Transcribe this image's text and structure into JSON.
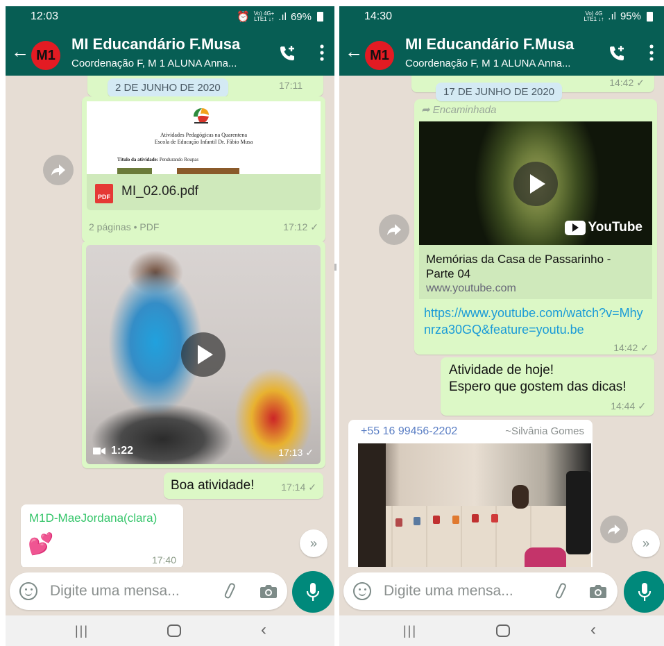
{
  "left": {
    "status": {
      "time": "12:03",
      "net_top": "Vo) 4G+",
      "net_bottom": "LTE1 ↓↑",
      "battery": "69%"
    },
    "header": {
      "avatar": "M1",
      "title": "MI Educandário F.Musa",
      "subtitle": "Coordenação F, M 1 ALUNA Anna..."
    },
    "messages": {
      "date_chip": "2 DE JUNHO DE 2020",
      "prev_time": "17:11",
      "pdf": {
        "doc_line1": "Atividades Pedagógicas na Quarentena",
        "doc_line2": "Escola de Educação Infantil Dr. Fábio Musa",
        "doc_label": "Título da atividade:",
        "doc_value": "Pendurando Roupas",
        "icon_text": "PDF",
        "filename": "MI_02.06.pdf",
        "pages": "2 páginas • PDF",
        "time": "17:12"
      },
      "video": {
        "duration": "1:22",
        "time": "17:13"
      },
      "text_out": {
        "text": "Boa atividade!",
        "time": "17:14"
      },
      "text_in": {
        "sender": "M1D-MaeJordana(clara)",
        "emoji": "💕",
        "time": "17:40"
      }
    },
    "input": {
      "placeholder": "Digite uma mensa..."
    }
  },
  "right": {
    "status": {
      "time": "14:30",
      "net_top": "Vo) 4G",
      "net_bottom": "LTE1 ↓↑",
      "battery": "95%"
    },
    "header": {
      "avatar": "M1",
      "title": "MI Educandário F.Musa",
      "subtitle": "Coordenação F, M 1 ALUNA Anna..."
    },
    "messages": {
      "date_chip": "17 DE JUNHO DE 2020",
      "prev_time": "14:42",
      "forwarded": "Encaminhada",
      "youtube": {
        "brand": "YouTube",
        "title": "Memórias da Casa de Passarinho - Parte 04",
        "domain": "www.youtube.com",
        "link": "https://www.youtube.com/watch?v=Mhynrza30GQ&feature=youtu.be",
        "time": "14:42"
      },
      "text_out": {
        "line1": "Atividade de hoje!",
        "line2": "Espero que gostem das dicas!",
        "time": "14:44"
      },
      "photo_in": {
        "phone": "+55 16 99456-2202",
        "name": "~Silvânia Gomes"
      }
    },
    "input": {
      "placeholder": "Digite uma mensa..."
    }
  },
  "colors": {
    "header": "#075e54",
    "bubble_out": "#dcf8c6",
    "bubble_in": "#ffffff",
    "chat_bg": "#e6ddd4",
    "mic": "#00897b",
    "link": "#1a9bd7",
    "sender": "#35c56a"
  },
  "icons": [
    "back-arrow-icon",
    "add-call-icon",
    "more-vert-icon",
    "forward-icon",
    "play-icon",
    "video-camera-icon",
    "double-chevron-down-icon",
    "emoji-icon",
    "attach-icon",
    "camera-icon",
    "mic-icon",
    "recents-icon",
    "home-icon",
    "nav-back-icon"
  ]
}
